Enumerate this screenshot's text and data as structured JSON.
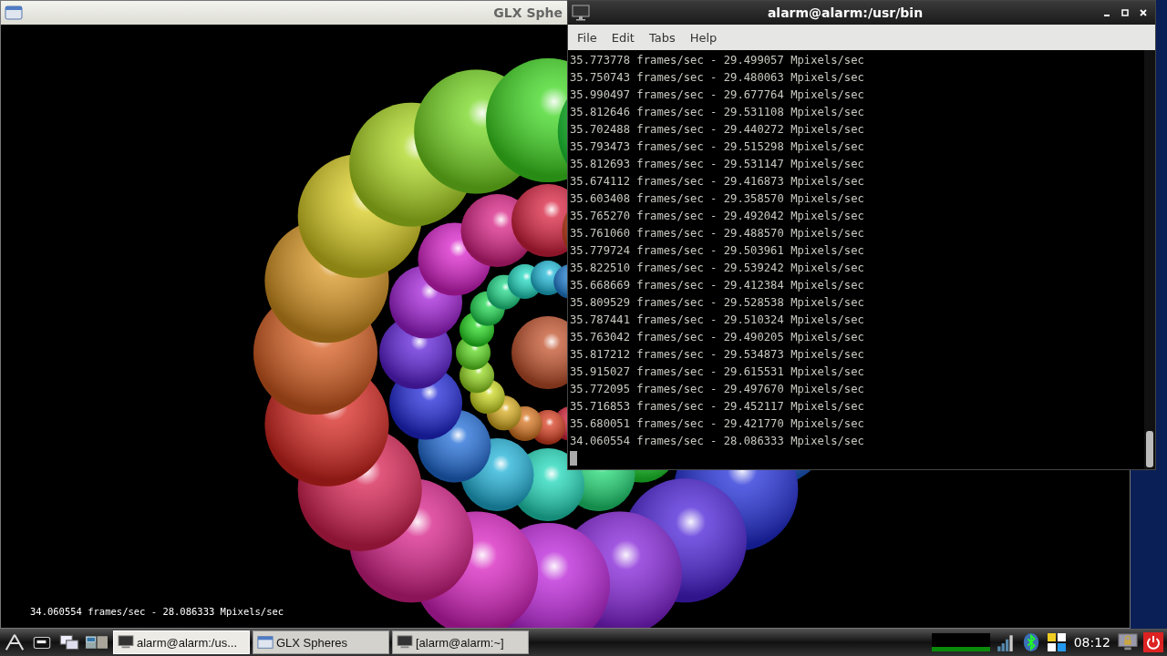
{
  "glx_window": {
    "title": "GLX Sphe",
    "overlay_text": "34.060554 frames/sec - 28.086333 Mpixels/sec"
  },
  "terminal": {
    "title": "alarm@alarm:/usr/bin",
    "menu": [
      "File",
      "Edit",
      "Tabs",
      "Help"
    ],
    "lines": [
      "35.773778 frames/sec - 29.499057 Mpixels/sec",
      "35.750743 frames/sec - 29.480063 Mpixels/sec",
      "35.990497 frames/sec - 29.677764 Mpixels/sec",
      "35.812646 frames/sec - 29.531108 Mpixels/sec",
      "35.702488 frames/sec - 29.440272 Mpixels/sec",
      "35.793473 frames/sec - 29.515298 Mpixels/sec",
      "35.812693 frames/sec - 29.531147 Mpixels/sec",
      "35.674112 frames/sec - 29.416873 Mpixels/sec",
      "35.603408 frames/sec - 29.358570 Mpixels/sec",
      "35.765270 frames/sec - 29.492042 Mpixels/sec",
      "35.761060 frames/sec - 29.488570 Mpixels/sec",
      "35.779724 frames/sec - 29.503961 Mpixels/sec",
      "35.822510 frames/sec - 29.539242 Mpixels/sec",
      "35.668669 frames/sec - 29.412384 Mpixels/sec",
      "35.809529 frames/sec - 29.528538 Mpixels/sec",
      "35.787441 frames/sec - 29.510324 Mpixels/sec",
      "35.763042 frames/sec - 29.490205 Mpixels/sec",
      "35.817212 frames/sec - 29.534873 Mpixels/sec",
      "35.915027 frames/sec - 29.615531 Mpixels/sec",
      "35.772095 frames/sec - 29.497670 Mpixels/sec",
      "35.716853 frames/sec - 29.452117 Mpixels/sec",
      "35.680051 frames/sec - 29.421770 Mpixels/sec",
      "34.060554 frames/sec - 28.086333 Mpixels/sec"
    ]
  },
  "taskbar": {
    "tasks": [
      {
        "label": "alarm@alarm:/us...",
        "kind": "terminal",
        "selected": true
      },
      {
        "label": "GLX Spheres",
        "kind": "window",
        "selected": false
      },
      {
        "label": "[alarm@alarm:~]",
        "kind": "terminal",
        "selected": false
      }
    ],
    "clock": "08:12"
  }
}
